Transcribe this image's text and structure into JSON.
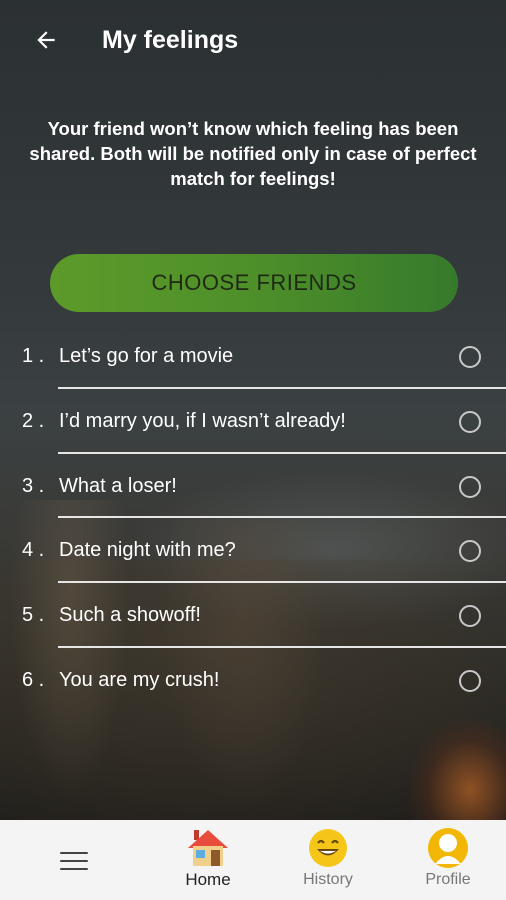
{
  "header": {
    "title": "My feelings",
    "back_icon": "arrow-left-icon"
  },
  "notice": "Your friend won’t know which feeling has been shared. Both will be notified only in case of perfect match for feelings!",
  "choose_button": "CHOOSE FRIENDS",
  "feelings": [
    {
      "number": "1 .",
      "text": "Let’s go for a movie",
      "selected": false
    },
    {
      "number": "2 .",
      "text": "I’d marry you, if I wasn’t already!",
      "selected": false
    },
    {
      "number": "3 .",
      "text": "What a loser!",
      "selected": false
    },
    {
      "number": "4 .",
      "text": "Date night with me?",
      "selected": false
    },
    {
      "number": "5 .",
      "text": "Such a showoff!",
      "selected": false
    },
    {
      "number": "6 .",
      "text": "You are my crush!",
      "selected": false
    }
  ],
  "bottom_nav": {
    "menu_icon": "hamburger-menu-icon",
    "tabs": [
      {
        "label": "Home",
        "icon": "house-icon",
        "active": true
      },
      {
        "label": "History",
        "icon": "smiley-face-icon",
        "active": false
      },
      {
        "label": "Profile",
        "icon": "user-avatar-icon",
        "active": false
      }
    ]
  },
  "colors": {
    "button_green": "#5c9b2a",
    "nav_background": "#f4f4f4",
    "divider": "#e6e6e6"
  }
}
